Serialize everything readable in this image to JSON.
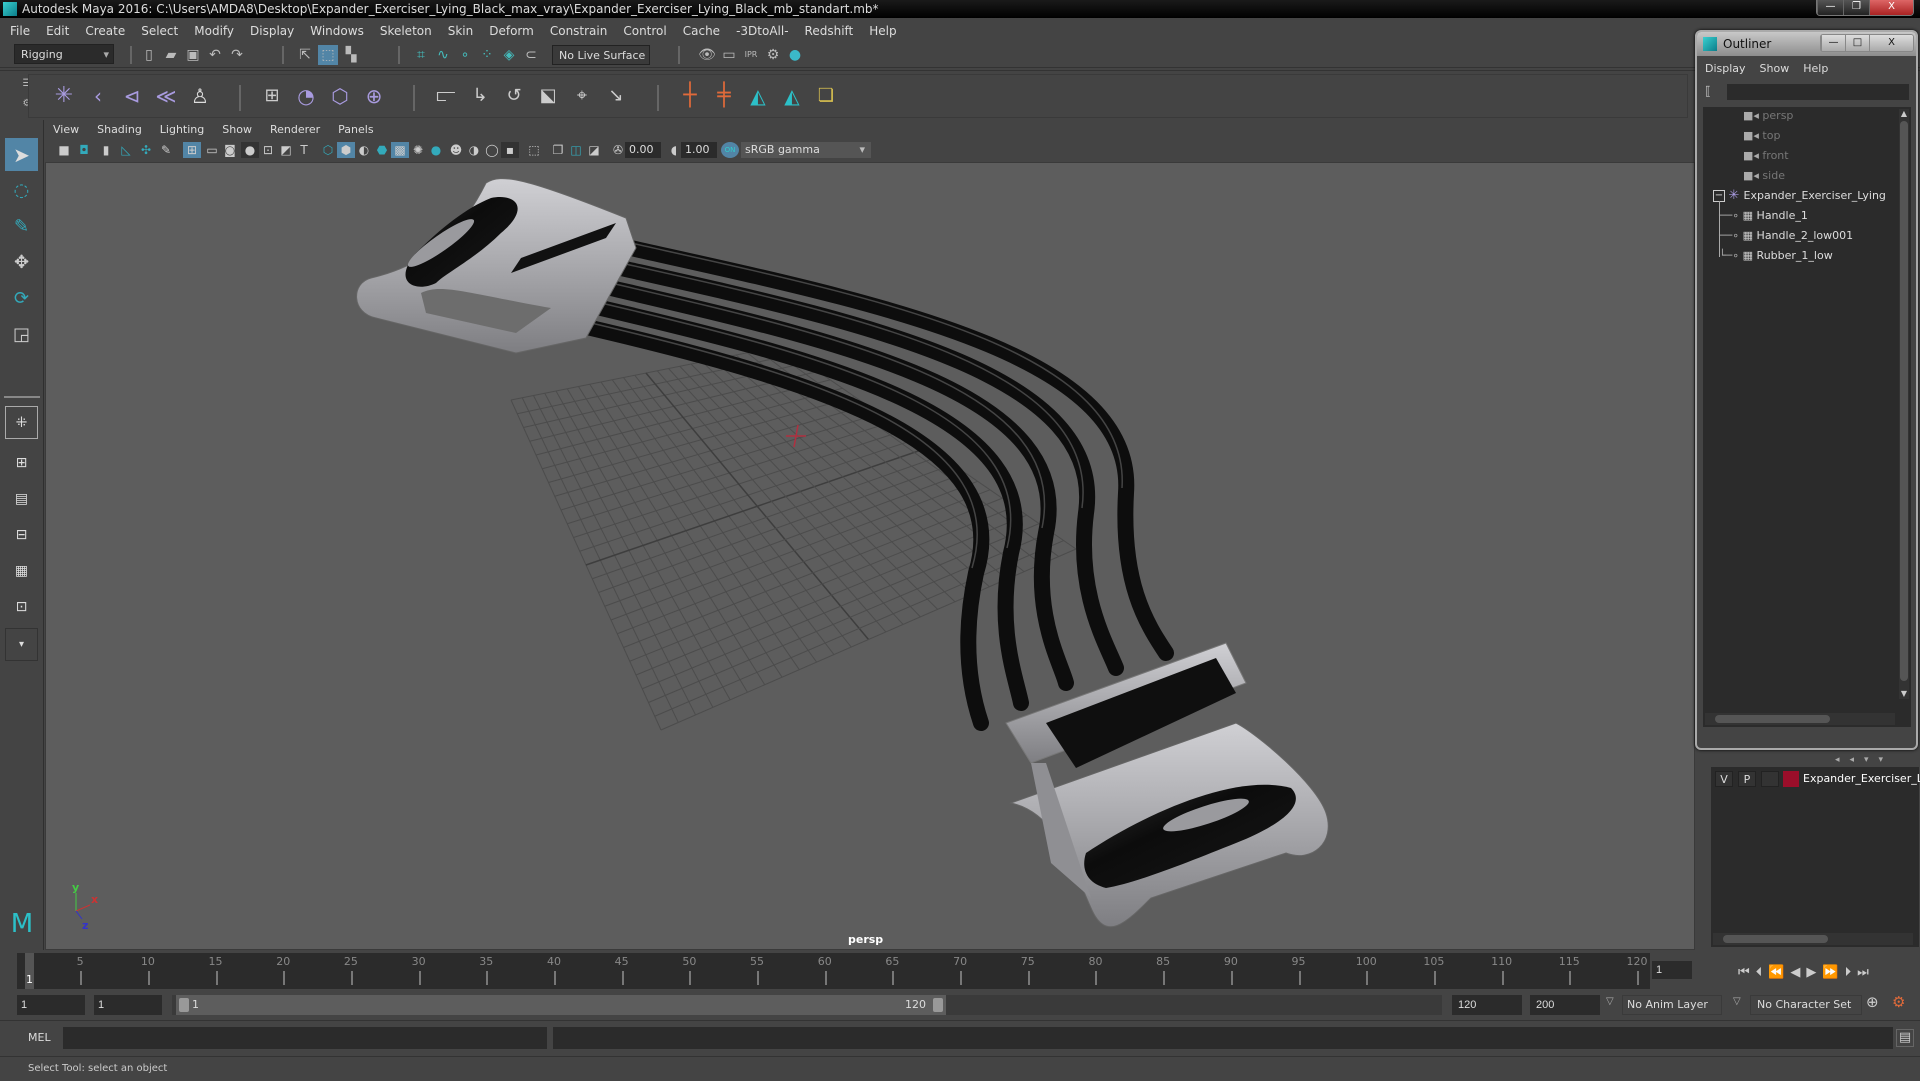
{
  "window": {
    "title": "Autodesk Maya 2016: C:\\Users\\AMDA8\\Desktop\\Expander_Exerciser_Lying_Black_max_vray\\Expander_Exerciser_Lying_Black_mb_standart.mb*",
    "minimize": "—",
    "restore": "❐",
    "close": "X"
  },
  "menubar": [
    "File",
    "Edit",
    "Create",
    "Select",
    "Modify",
    "Display",
    "Windows",
    "Skeleton",
    "Skin",
    "Deform",
    "Constrain",
    "Control",
    "Cache",
    "-3DtoAll-",
    "Redshift",
    "Help"
  ],
  "statusline": {
    "menuset": "Rigging",
    "live_surface": "No Live Surface"
  },
  "viewport": {
    "menus": [
      "View",
      "Shading",
      "Lighting",
      "Show",
      "Renderer",
      "Panels"
    ],
    "exposure": "0.00",
    "gamma": "1.00",
    "color_space": "sRGB gamma",
    "camera_label": "persp",
    "axis": {
      "x": "x",
      "y": "y",
      "z": "z"
    },
    "colors": {
      "background": "#5d5d5d",
      "grid": "#4a4a4a",
      "origin": "#b03040",
      "metal": "#b4b4b8",
      "rubber": "#111111"
    }
  },
  "outliner": {
    "title": "Outliner",
    "menus": [
      "Display",
      "Show",
      "Help"
    ],
    "items": [
      {
        "label": "persp",
        "type": "camera",
        "dim": true
      },
      {
        "label": "top",
        "type": "camera",
        "dim": true
      },
      {
        "label": "front",
        "type": "camera",
        "dim": true
      },
      {
        "label": "side",
        "type": "camera",
        "dim": true
      },
      {
        "label": "Expander_Exerciser_Lying",
        "type": "group",
        "expanded": true
      },
      {
        "label": "Handle_1",
        "type": "mesh",
        "child": true
      },
      {
        "label": "Handle_2_low001",
        "type": "mesh",
        "child": true
      },
      {
        "label": "Rubber_1_low",
        "type": "mesh",
        "child": true
      }
    ]
  },
  "layer_editor": {
    "layers": [
      {
        "v": "V",
        "p": "P",
        "color": "#9b0e2a",
        "name": "Expander_Exerciser_Lyi"
      }
    ]
  },
  "timeline": {
    "ticks": [
      5,
      10,
      15,
      20,
      25,
      30,
      35,
      40,
      45,
      50,
      55,
      60,
      65,
      70,
      75,
      80,
      85,
      90,
      95,
      100,
      105,
      110,
      115,
      120
    ],
    "start": 1,
    "end": 120,
    "current_frame_marker": "1",
    "current_frame": "1"
  },
  "range": {
    "start": "1",
    "playback_start": "1",
    "slider_start": "1",
    "slider_end": "120",
    "playback_end": "120",
    "end": "200",
    "anim_layer": "No Anim Layer",
    "character_set": "No Character Set"
  },
  "command_line": {
    "language": "MEL",
    "value": ""
  },
  "help_line": "Select Tool: select an object"
}
